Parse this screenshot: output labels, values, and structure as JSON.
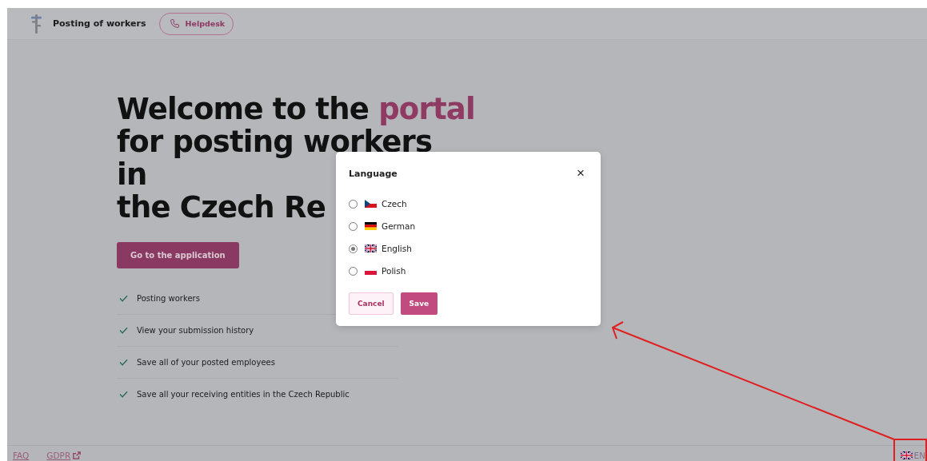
{
  "header": {
    "title": "Posting of workers",
    "helpdesk": "Helpdesk"
  },
  "hero": {
    "heading": [
      [
        {
          "text": "Welcome to the ",
          "accent": false
        },
        {
          "text": "portal",
          "accent": true
        }
      ],
      [
        {
          "text": "for posting workers",
          "accent": false
        }
      ],
      [
        {
          "text": "in",
          "accent": false
        }
      ],
      [
        {
          "text": "the Czech Re",
          "accent": false
        }
      ]
    ],
    "cta": "Go to the application",
    "features": [
      "Posting workers",
      "View your submission history",
      "Save all of your posted employees",
      "Save all your receiving entities in the Czech Republic"
    ]
  },
  "dialog": {
    "title": "Language",
    "close": "×",
    "options": [
      {
        "label": "Czech",
        "kind": "cz",
        "selected": false
      },
      {
        "label": "German",
        "kind": "de",
        "selected": false
      },
      {
        "label": "English",
        "kind": "gb",
        "selected": true
      },
      {
        "label": "Polish",
        "kind": "pl",
        "selected": false
      }
    ],
    "cancel": "Cancel",
    "save": "Save"
  },
  "footer": {
    "links": [
      {
        "label": "FAQ",
        "external": false
      },
      {
        "label": "GDPR",
        "external": true
      }
    ],
    "language": {
      "kind": "gb",
      "label": "EN"
    }
  }
}
